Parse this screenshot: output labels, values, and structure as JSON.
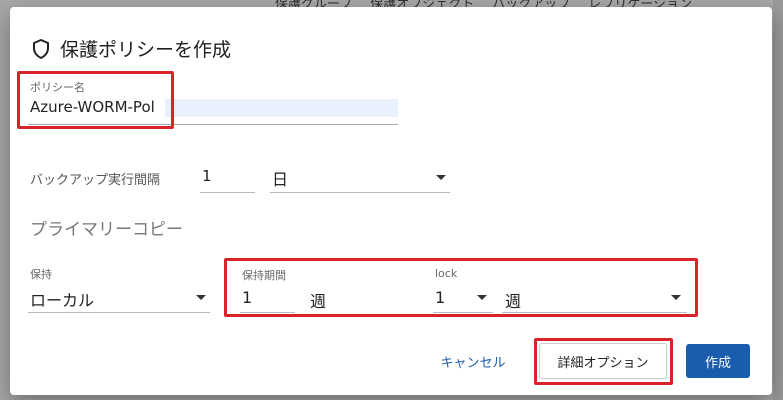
{
  "background": {
    "tabs": [
      "保護グループ",
      "保護オブジェクト",
      "バックアップ",
      "レプリケーション"
    ]
  },
  "dialog": {
    "title": "保護ポリシーを作成",
    "title_icon": "shield-icon",
    "policy_name": {
      "label": "ポリシー名",
      "value": "Azure-WORM-Pol"
    },
    "backup_interval": {
      "label": "バックアップ実行間隔",
      "value": "1",
      "unit": "日"
    },
    "primary_copy": {
      "section_title": "プライマリーコピー",
      "retention": {
        "label": "保持",
        "value": "ローカル"
      },
      "retention_period": {
        "label": "保持期間",
        "value": "1",
        "unit": "週"
      },
      "lock": {
        "label": "lock",
        "value": "1",
        "unit": "週"
      }
    },
    "buttons": {
      "cancel": "キャンセル",
      "advanced": "詳細オプション",
      "create": "作成"
    }
  },
  "colors": {
    "accent": "#1a5cae",
    "highlight": "#d9232a",
    "autofill": "#e8f0fe"
  }
}
